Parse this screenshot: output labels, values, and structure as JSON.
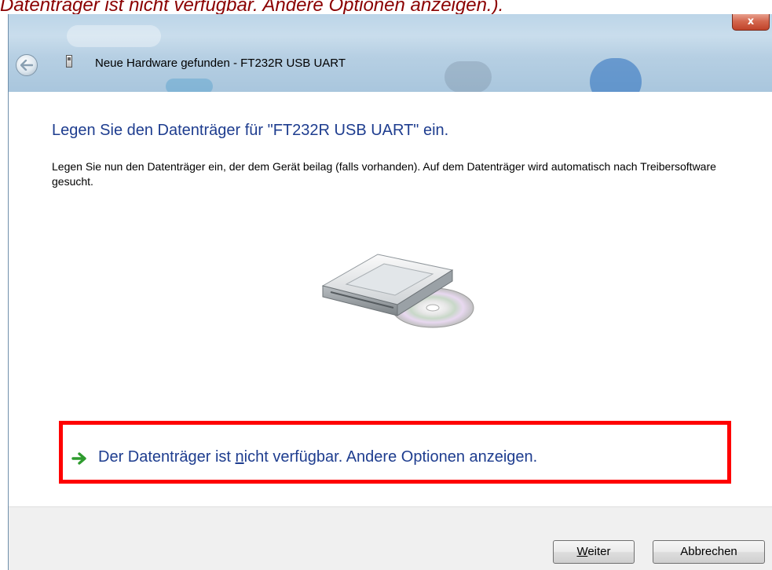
{
  "caption": "Datenträger ist nicht verfügbar. Andere Optionen anzeigen.).",
  "window": {
    "title": "Neue Hardware gefunden - FT232R USB UART",
    "close_label": "x"
  },
  "content": {
    "heading": "Legen Sie den Datenträger für \"FT232R USB UART\" ein.",
    "description": "Legen Sie nun den Datenträger ein, der dem Gerät beilag (falls vorhanden). Auf dem Datenträger wird automatisch nach Treibersoftware gesucht.",
    "option_link": {
      "prefix": "Der Datenträger ist ",
      "accesskey": "n",
      "suffix": "icht verfügbar. Andere Optionen anzeigen."
    }
  },
  "footer": {
    "next_button": {
      "accesskey": "W",
      "rest": "eiter"
    },
    "cancel_button": "Abbrechen"
  },
  "colors": {
    "heading": "#1e3d8f",
    "link": "#1e3d8f",
    "highlight_border": "#ff0000",
    "caption": "#8b0000"
  },
  "icons": [
    "back-arrow-icon",
    "usb-device-icon",
    "disc-drive-icon",
    "green-arrow-icon",
    "close-icon"
  ]
}
